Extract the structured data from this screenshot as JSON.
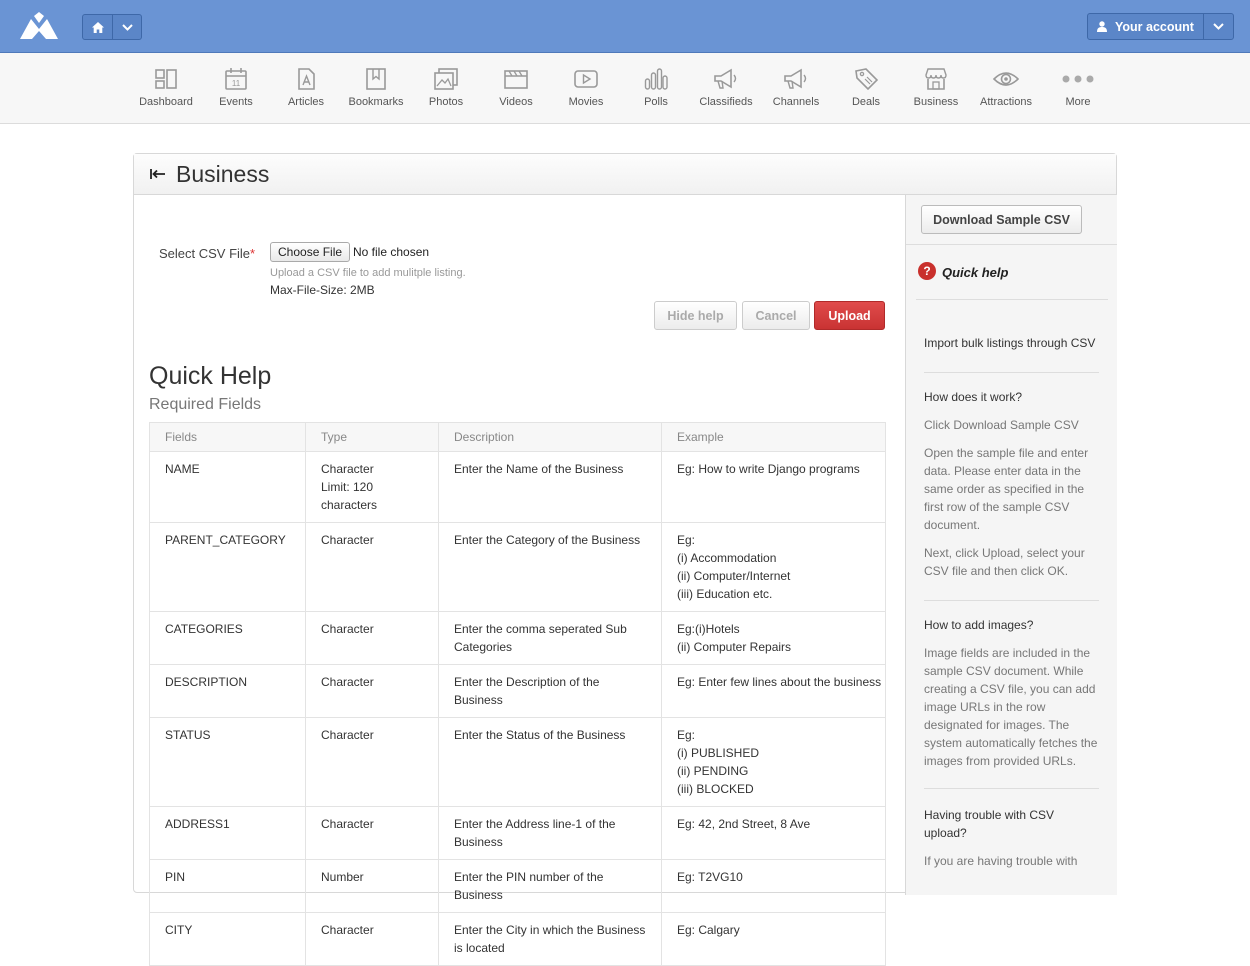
{
  "topbar": {
    "brand": "logo",
    "home_icon": "home-icon",
    "dropdown_icon": "chevron-down-icon",
    "account_label": "Your account",
    "account_icon": "user-icon"
  },
  "nav": [
    {
      "label": "Dashboard",
      "icon": "dashboard-icon"
    },
    {
      "label": "Events",
      "icon": "calendar-icon",
      "icon_text": "11"
    },
    {
      "label": "Articles",
      "icon": "article-icon"
    },
    {
      "label": "Bookmarks",
      "icon": "bookmark-icon"
    },
    {
      "label": "Photos",
      "icon": "photo-icon"
    },
    {
      "label": "Videos",
      "icon": "video-icon"
    },
    {
      "label": "Movies",
      "icon": "play-icon"
    },
    {
      "label": "Polls",
      "icon": "poll-icon"
    },
    {
      "label": "Classifieds",
      "icon": "megaphone-icon"
    },
    {
      "label": "Channels",
      "icon": "megaphone-icon"
    },
    {
      "label": "Deals",
      "icon": "tag-icon"
    },
    {
      "label": "Business",
      "icon": "store-icon"
    },
    {
      "label": "Attractions",
      "icon": "eye-icon"
    },
    {
      "label": "More",
      "icon": "more-icon"
    }
  ],
  "panel": {
    "title": "Business",
    "back_icon": "back-arrow-icon"
  },
  "form": {
    "label": "Select CSV File",
    "required_mark": "*",
    "choose_file": "Choose File",
    "file_state": "No file chosen",
    "hint": "Upload a CSV file to add mulitple listing.",
    "max_size": "Max-File-Size: 2MB",
    "hide_help": "Hide help",
    "cancel": "Cancel",
    "upload": "Upload"
  },
  "quick_help": {
    "title": "Quick Help",
    "subtitle": "Required Fields",
    "columns": [
      "Fields",
      "Type",
      "Description",
      "Example"
    ],
    "rows": [
      {
        "field": "NAME",
        "type": [
          "Character",
          "Limit: 120 characters"
        ],
        "description": "Enter the Name of the Business",
        "example": [
          "Eg: How to write Django programs"
        ]
      },
      {
        "field": "PARENT_CATEGORY",
        "type": [
          "Character"
        ],
        "description": "Enter the Category of the Business",
        "example": [
          "Eg:",
          "(i) Accommodation",
          "(ii) Computer/Internet",
          "(iii) Education etc."
        ]
      },
      {
        "field": "CATEGORIES",
        "type": [
          "Character"
        ],
        "description": "Enter the comma seperated Sub Categories",
        "example": [
          "Eg:(i)Hotels",
          "(ii) Computer Repairs"
        ]
      },
      {
        "field": "DESCRIPTION",
        "type": [
          "Character"
        ],
        "description": "Enter the Description of the Business",
        "example": [
          "Eg: Enter few lines about the business"
        ]
      },
      {
        "field": "STATUS",
        "type": [
          "Character"
        ],
        "description": "Enter the Status of the Business",
        "example": [
          "Eg:",
          "(i) PUBLISHED",
          "(ii) PENDING",
          "(iii) BLOCKED"
        ]
      },
      {
        "field": "ADDRESS1",
        "type": [
          "Character"
        ],
        "description": "Enter the Address line-1 of the Business",
        "example": [
          "Eg: 42, 2nd Street, 8 Ave"
        ]
      },
      {
        "field": "PIN",
        "type": [
          "Number"
        ],
        "description": "Enter the PIN number of the Business",
        "example": [
          "Eg: T2VG10"
        ]
      },
      {
        "field": "CITY",
        "type": [
          "Character"
        ],
        "description": "Enter the City in which the Business is located",
        "example": [
          "Eg: Calgary"
        ]
      }
    ]
  },
  "sidebar": {
    "download_button": "Download Sample CSV",
    "quick_help_label": "Quick help",
    "quick_help_icon": "question-icon",
    "intro": "Import bulk listings through CSV",
    "how_title": "How does it work?",
    "how_step1": "Click Download Sample CSV",
    "how_step2": "Open the sample file and enter data. Please enter data in the same order as specified in the first row of the sample CSV document.",
    "how_step3": "Next, click Upload, select your CSV file and then click OK.",
    "images_title": "How to add images?",
    "images_text": "Image fields are included in the sample CSV document. While creating a CSV file, you can add image URLs in the row designated for images. The system automatically fetches the images from provided URLs.",
    "trouble_title": "Having trouble with CSV upload?",
    "trouble_text": "If you are having trouble with"
  },
  "colors": {
    "topbar": "#6a94d4",
    "upload_button": "#d33c3c",
    "help_icon": "#c9302c"
  }
}
